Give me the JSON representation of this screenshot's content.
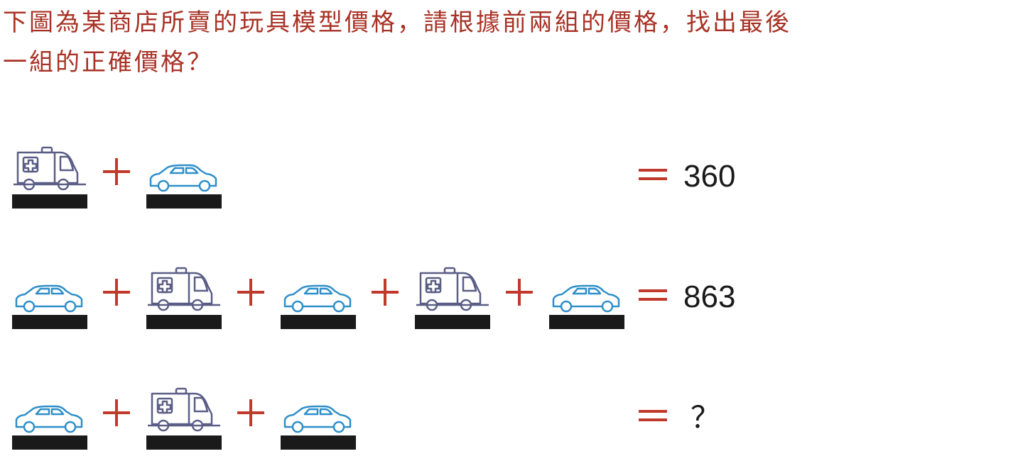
{
  "question": {
    "line1": "下圖為某商店所賣的玩具模型價格，請根據前兩組的價格，找出最後",
    "line2": "一組的正確價格？"
  },
  "colors": {
    "question_text": "#a83226",
    "operator": "#c0392b",
    "car_icon": "#2e8fc9",
    "ambulance_icon": "#5a5e86",
    "base": "#1a1a1a"
  },
  "equations": [
    {
      "items": [
        "ambulance-icon",
        "car-icon"
      ],
      "operator": "+",
      "equals": "=",
      "result": "360"
    },
    {
      "items": [
        "car-icon",
        "ambulance-icon",
        "car-icon",
        "ambulance-icon",
        "car-icon"
      ],
      "operator": "+",
      "equals": "=",
      "result": "863"
    },
    {
      "items": [
        "car-icon",
        "ambulance-icon",
        "car-icon"
      ],
      "operator": "+",
      "equals": "=",
      "result": "？"
    }
  ]
}
